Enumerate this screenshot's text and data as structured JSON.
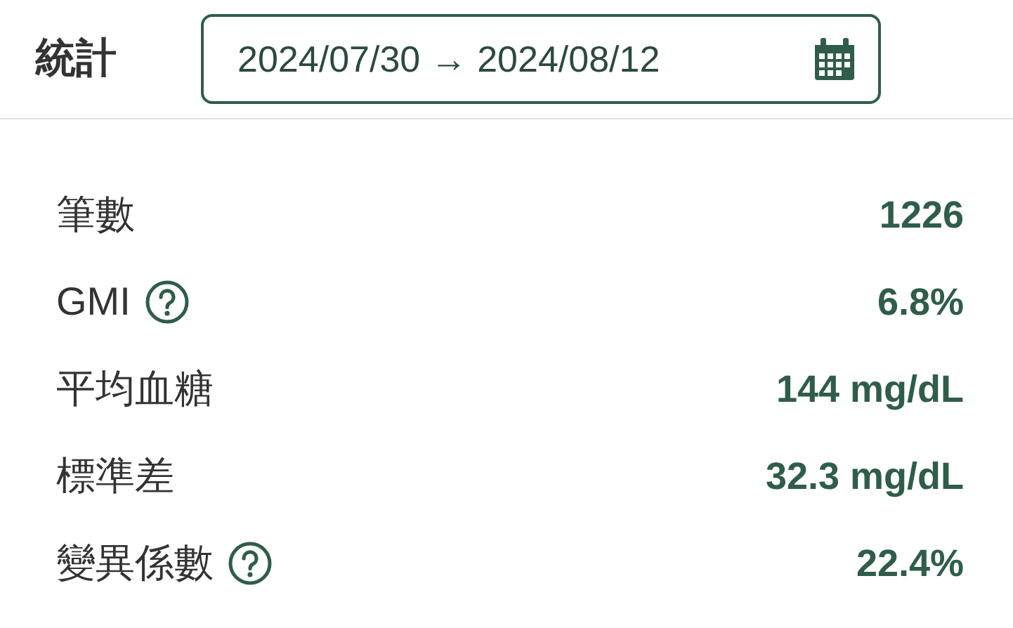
{
  "header": {
    "title": "統計",
    "date_range": "2024/07/30 → 2024/08/12"
  },
  "stats": [
    {
      "label": "筆數",
      "help": false,
      "value": "1226"
    },
    {
      "label": "GMI",
      "help": true,
      "value": "6.8%"
    },
    {
      "label": "平均血糖",
      "help": false,
      "value": "144 mg/dL"
    },
    {
      "label": "標準差",
      "help": false,
      "value": "32.3 mg/dL"
    },
    {
      "label": "變異係數",
      "help": true,
      "value": "22.4%"
    }
  ]
}
